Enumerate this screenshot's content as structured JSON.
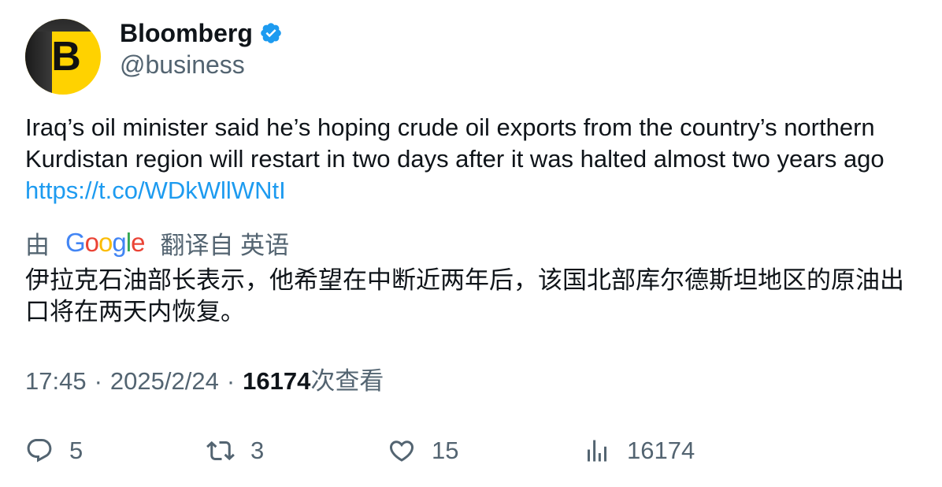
{
  "author": {
    "display_name": "Bloomberg",
    "handle": "@business",
    "avatar_letter": "B",
    "verified": true
  },
  "tweet": {
    "text": "Iraq’s oil minister said he’s hoping crude oil exports from the country’s northern Kurdistan region will restart in two days after it was halted almost two years ago",
    "link": "https://t.co/WDkWllWNtI"
  },
  "translation": {
    "prefix": "由",
    "provider": "Google",
    "suffix": "翻译自 英语",
    "text": "伊拉克石油部长表示，他希望在中断近两年后，该国北部库尔德斯坦地区的原油出口将在两天内恢复。"
  },
  "meta": {
    "time": "17:45",
    "separator": "·",
    "date": "2025/2/24",
    "views_count": "16174",
    "views_label": "次查看"
  },
  "actions": {
    "replies": "5",
    "retweets": "3",
    "likes": "15",
    "views": "16174"
  },
  "colors": {
    "accent": "#1d9bf0",
    "secondary_text": "#536471",
    "primary_text": "#0f1419",
    "avatar_bg": "#ffd200"
  },
  "icons": [
    "verified-badge-icon",
    "reply-icon",
    "retweet-icon",
    "like-icon",
    "views-icon"
  ]
}
